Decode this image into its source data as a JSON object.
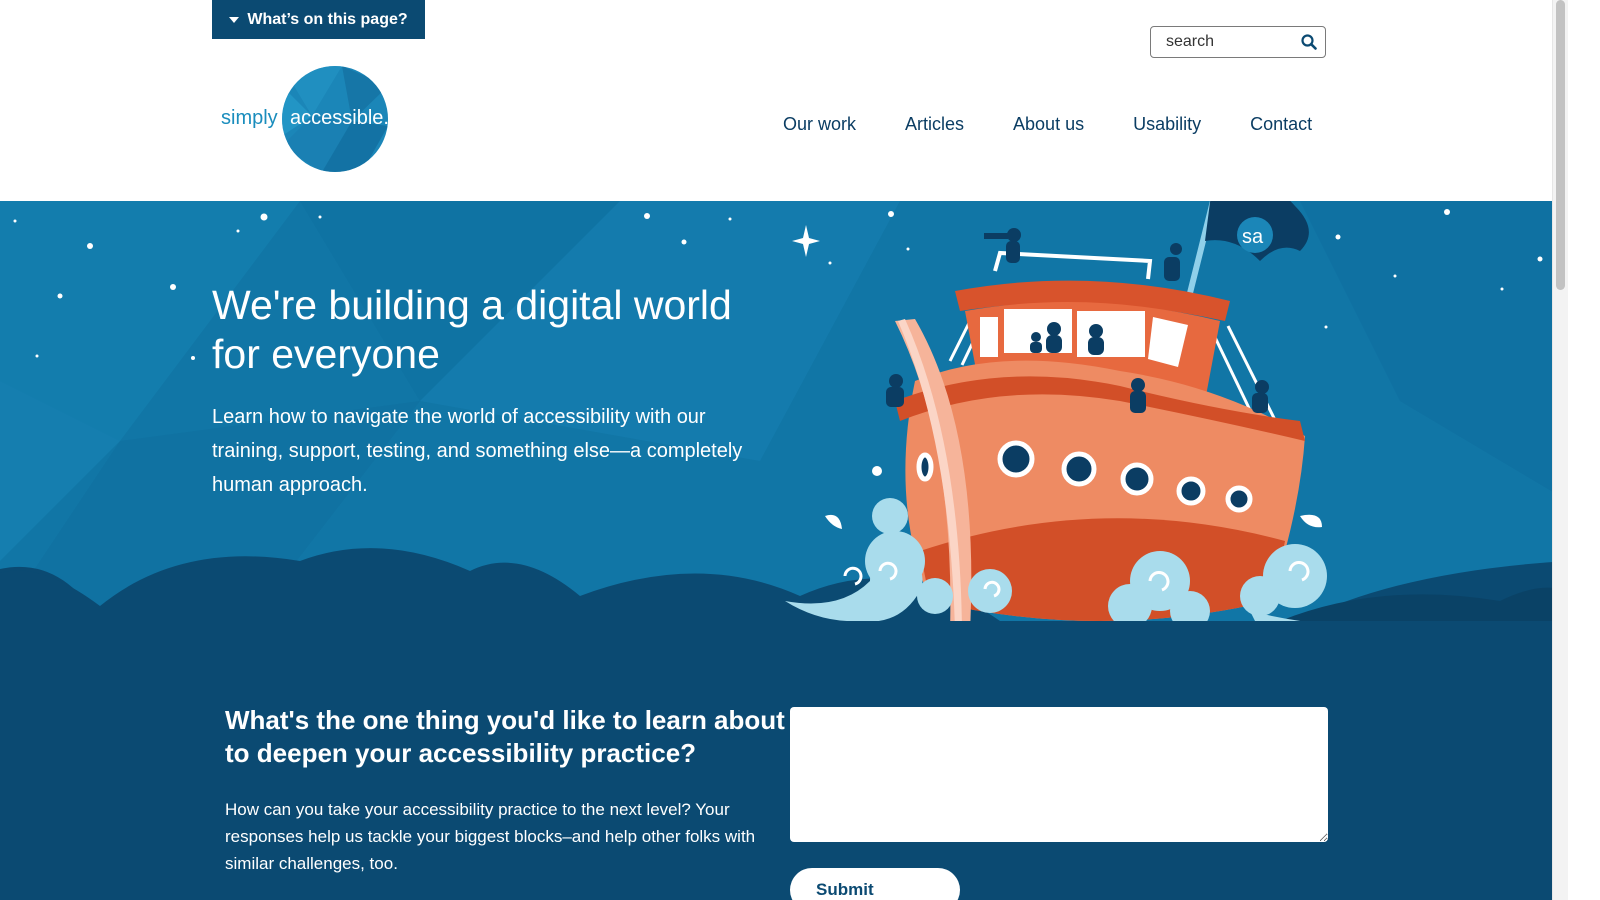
{
  "skip_menu": {
    "label": "What’s on this page?"
  },
  "logo": {
    "word1": "simply",
    "word2": "accessible.",
    "flag_text": "sa"
  },
  "search": {
    "placeholder": "search"
  },
  "nav": {
    "items": [
      {
        "label": "Our work"
      },
      {
        "label": "Articles"
      },
      {
        "label": "About us"
      },
      {
        "label": "Usability"
      },
      {
        "label": "Contact"
      }
    ]
  },
  "hero": {
    "title": "We're building a digital world for everyone",
    "text": "Learn how to navigate the world of accessibility with our training, support, testing, and something else—a completely human approach."
  },
  "question": {
    "title": "What's the one thing you'd like to learn about to deepen your accessibility practice?",
    "text": "How can you take your accessibility practice to the next level? Your responses help us tackle your biggest blocks–and help other folks with similar challenges, too.",
    "answer_value": "",
    "submit_label": "Submit"
  },
  "colors": {
    "brand_dark": "#0b4a72",
    "hero_blue": "#1176a6",
    "boat_orange": "#e7693f",
    "nav_text": "#0b3d63"
  }
}
